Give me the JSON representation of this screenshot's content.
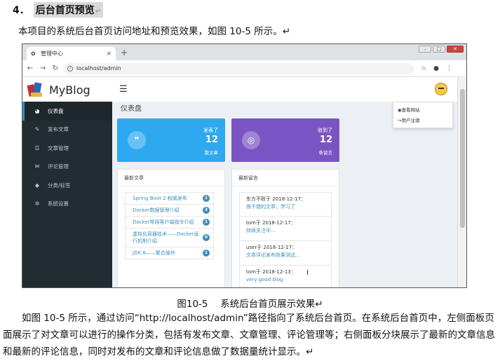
{
  "document": {
    "section_number": "4．",
    "section_title": "后台首页预览",
    "paragraph_mark": "↵",
    "intro": "本项目的系统后台首页访问地址和预览效果，如图 10-5 所示。↵",
    "caption": "图10-5　 系统后台首页展示效果↵",
    "body_text": "如图 10-5 所示，通过访问“http://localhost/admin”路径指向了系统后台首页。在系统后台首页中，左侧面板页面展示了对文章可以进行的操作分类，包括有发布文章、文章管理、评论管理等；右侧面板分块展示了最新的文章信息和最新的评论信息，同时对发布的文章和评论信息做了数据量统计显示。↵"
  },
  "browser": {
    "tab_title": "管理中心",
    "url": "localhost/admin",
    "new_tab_symbol": "+",
    "tab_close_symbol": "×"
  },
  "app": {
    "brand": "MyBlog",
    "menu": [
      {
        "label": "仪表盘",
        "icon": "dashboard-icon",
        "glyph": "◕",
        "active": true
      },
      {
        "label": "发布文章",
        "icon": "edit-icon",
        "glyph": "✎",
        "active": false
      },
      {
        "label": "文章管理",
        "icon": "list-icon",
        "glyph": "☰",
        "active": false
      },
      {
        "label": "评论管理",
        "icon": "comments-icon",
        "glyph": "✉",
        "active": false
      },
      {
        "label": "分类/标签",
        "icon": "tags-icon",
        "glyph": "◆",
        "active": false
      },
      {
        "label": "系统设置",
        "icon": "gear-icon",
        "glyph": "✲",
        "active": false
      }
    ],
    "dropdown": {
      "view_site": "◉查看网站",
      "logout": "↪用户注销"
    },
    "page_title": "仪表盘",
    "stats": [
      {
        "label": "发表了",
        "value": "12",
        "unit": "篇文章",
        "icon": "quote-icon",
        "glyph": "❞",
        "color": "#2ea9f0"
      },
      {
        "label": "收到了",
        "value": "12",
        "unit": "条留言",
        "icon": "comment-icon",
        "glyph": "◎",
        "color": "#7b54c4"
      }
    ],
    "latest_articles": {
      "title": "最新文章",
      "items": [
        {
          "title": "Spring Boot 2 权威发布",
          "badge": "1"
        },
        {
          "title": "Docker数据管理介绍",
          "badge": "3"
        },
        {
          "title": "Docker常用客户端指令介绍",
          "badge": "1"
        },
        {
          "title": "虚拟化容器技术——Docker运行机制介绍",
          "badge": "0"
        },
        {
          "title": "JDK 8——聚合操作",
          "badge": "1"
        }
      ]
    },
    "latest_comments": {
      "title": "最新留言",
      "items": [
        {
          "who": "东方不败于 2018-12-17：",
          "text": "很不错的文章，学习了"
        },
        {
          "who": "tom于 2018-12-17：",
          "text": "持续关注中..."
        },
        {
          "who": "user于 2018-12-17：",
          "text": "文章评论发布效果测试..."
        },
        {
          "who": "tom于 2018-12-13：",
          "text": "very good blog"
        }
      ]
    },
    "colors": {
      "sidebar": "#222d32",
      "link": "#3c8dbc",
      "blue_box": "#2ea9f0",
      "purple_box": "#7b54c4"
    }
  }
}
